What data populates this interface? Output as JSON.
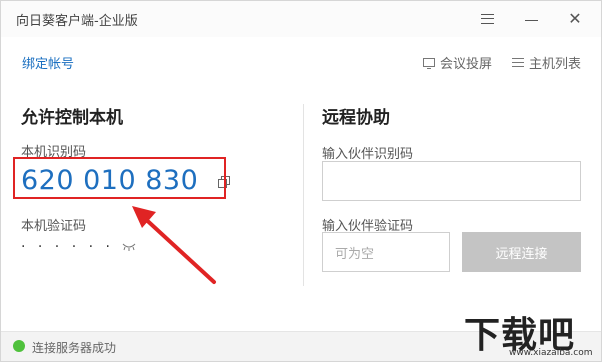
{
  "window": {
    "title": "向日葵客户端-企业版"
  },
  "toolbar": {
    "bind_account": "绑定帐号",
    "meeting_cast": "会议投屏",
    "host_list": "主机列表"
  },
  "allow_control": {
    "title": "允许控制本机",
    "id_label": "本机识别码",
    "id_value": "620 010 830",
    "password_label": "本机验证码",
    "password_masked": "· · · · · ·"
  },
  "remote_assist": {
    "title": "远程协助",
    "partner_id_label": "输入伙伴识别码",
    "partner_pwd_label": "输入伙伴验证码",
    "partner_pwd_placeholder": "可为空",
    "connect_button": "远程连接"
  },
  "status": {
    "text": "连接服务器成功",
    "color": "#4fc13c"
  },
  "annotation": {
    "highlight_color": "#e02424"
  },
  "watermark": {
    "logo": "下载吧",
    "url": "www.xiazaiba.com"
  }
}
